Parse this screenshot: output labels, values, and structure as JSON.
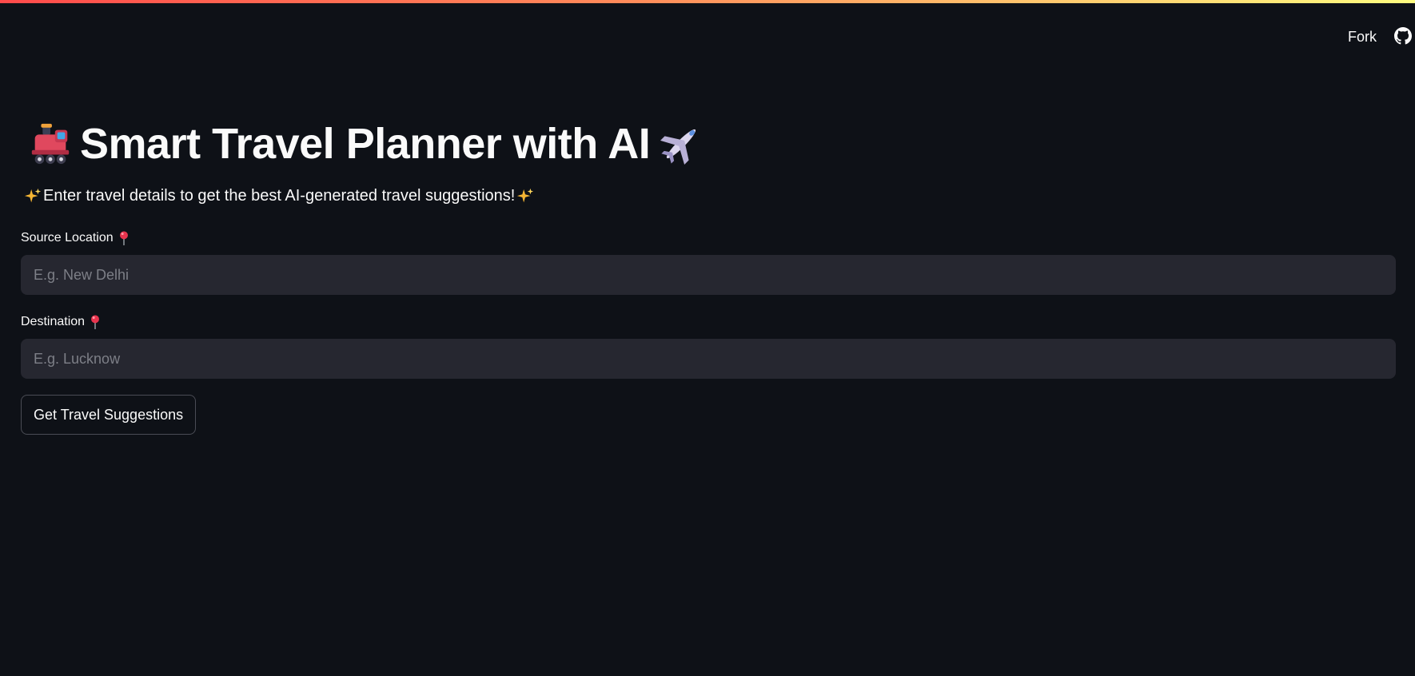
{
  "header": {
    "fork_label": "Fork",
    "github_icon": "github-icon",
    "decoration_gradient": [
      "#ff4b4b",
      "#ff8c5a",
      "#fffd80"
    ]
  },
  "page": {
    "title": "Smart Travel Planner with AI",
    "title_icons": [
      "train-emoji-icon",
      "airplane-emoji-icon"
    ],
    "subtitle": "Enter travel details to get the best AI-generated travel suggestions!",
    "subtitle_icons": [
      "sparkles-emoji-icon",
      "sparkles-emoji-icon"
    ]
  },
  "form": {
    "source": {
      "label": "Source Location",
      "icon": "pin-emoji-icon",
      "value": "",
      "placeholder": "E.g. New Delhi"
    },
    "destination": {
      "label": "Destination",
      "icon": "pin-emoji-icon",
      "value": "",
      "placeholder": "E.g. Lucknow"
    },
    "submit_label": "Get Travel Suggestions"
  },
  "colors": {
    "background": "#0e1117",
    "input_background": "#262730",
    "text": "#fafafa",
    "placeholder": "#7d7f87"
  }
}
